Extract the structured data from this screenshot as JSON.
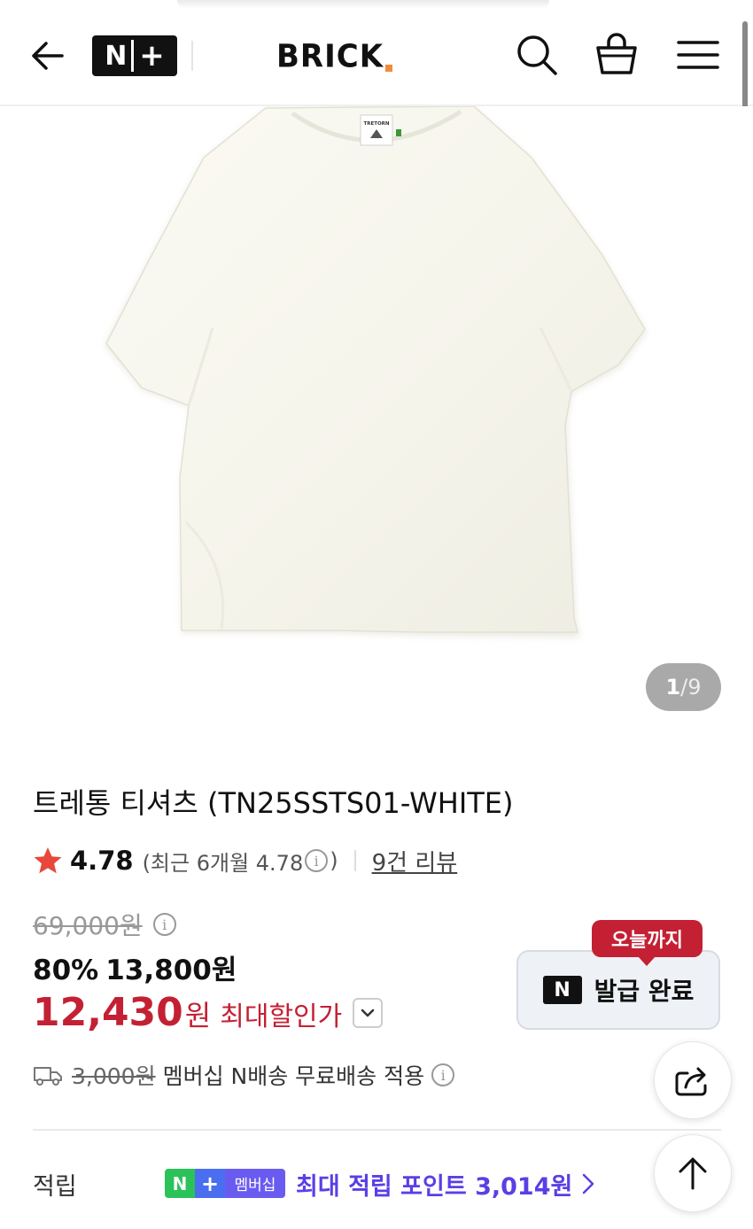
{
  "header": {
    "badge_n": "N",
    "badge_plus": "+",
    "logo_text": "BRICK"
  },
  "gallery": {
    "current": "1",
    "separator": "/",
    "total": "9",
    "tag_text": "TRETORN"
  },
  "product": {
    "title": "트레통 티셔츠 (TN25SSTS01-WHITE)",
    "rating": "4.78",
    "recent_prefix": "(최근 6개월 4.78",
    "recent_suffix": ")",
    "review_link": "9건 리뷰",
    "original_price": "69,000원",
    "discount_percent": "80%",
    "discount_price": "13,800원",
    "max_price": "12,430",
    "max_price_unit": "원",
    "max_price_label": "최대할인가"
  },
  "coupon": {
    "badge": "오늘까지",
    "n_mark": "N",
    "status": "발급 완료"
  },
  "shipping": {
    "fee": "3,000원",
    "description": "멤버십 N배송 무료배송 적용"
  },
  "points": {
    "label": "적립",
    "chip_n": "N",
    "chip_plus": "+",
    "chip_membership": "멤버십",
    "text": "최대 적립 포인트 3,014원"
  },
  "colors": {
    "accent_red": "#c42034",
    "point_purple": "#5a3fe6",
    "star": "#e8473b"
  }
}
